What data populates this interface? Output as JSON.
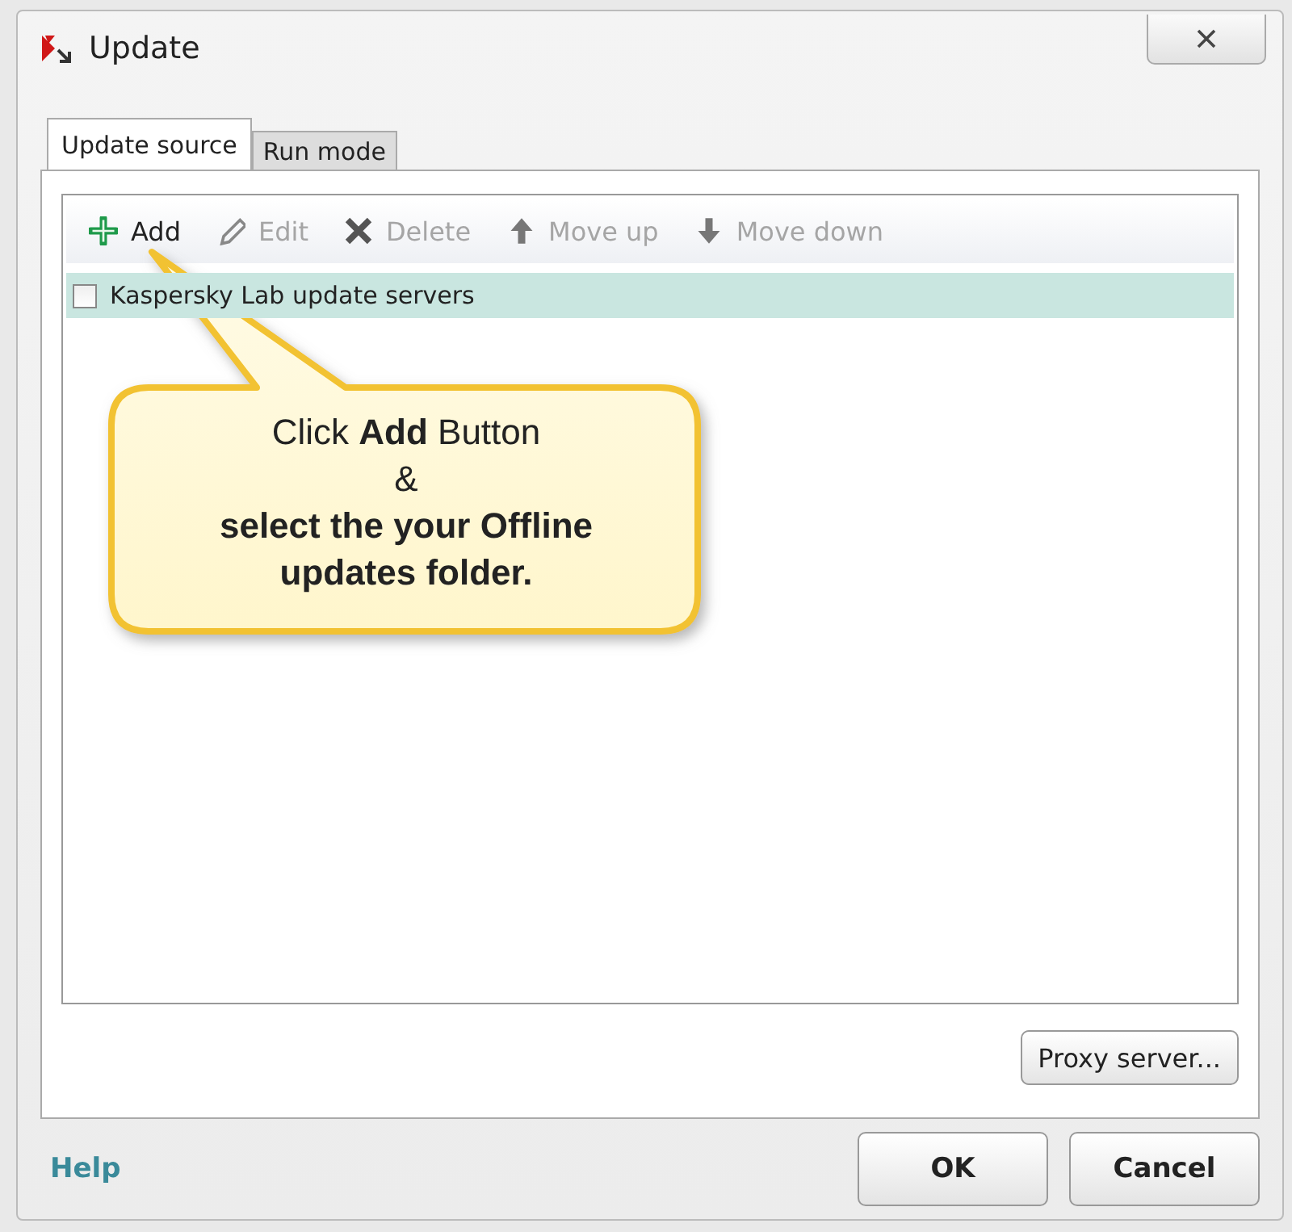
{
  "window": {
    "title": "Update"
  },
  "tabs": [
    {
      "label": "Update source",
      "selected": true
    },
    {
      "label": "Run mode",
      "selected": false
    }
  ],
  "toolbar": [
    {
      "label": "Add",
      "kind": "add",
      "disabled": false
    },
    {
      "label": "Edit",
      "kind": "edit",
      "disabled": true
    },
    {
      "label": "Delete",
      "kind": "delete",
      "disabled": true
    },
    {
      "label": "Move up",
      "kind": "up",
      "disabled": true
    },
    {
      "label": "Move down",
      "kind": "down",
      "disabled": true
    }
  ],
  "sources": [
    {
      "name": "Kaspersky Lab update servers",
      "checked": false,
      "selected": true
    }
  ],
  "callout": {
    "lines": [
      "Click **Add** Button",
      "&",
      "**select the your Offline**",
      "**updates folder.**"
    ]
  },
  "proxy_button": "Proxy server...",
  "help_link": "Help",
  "buttons": [
    "OK",
    "Cancel"
  ]
}
